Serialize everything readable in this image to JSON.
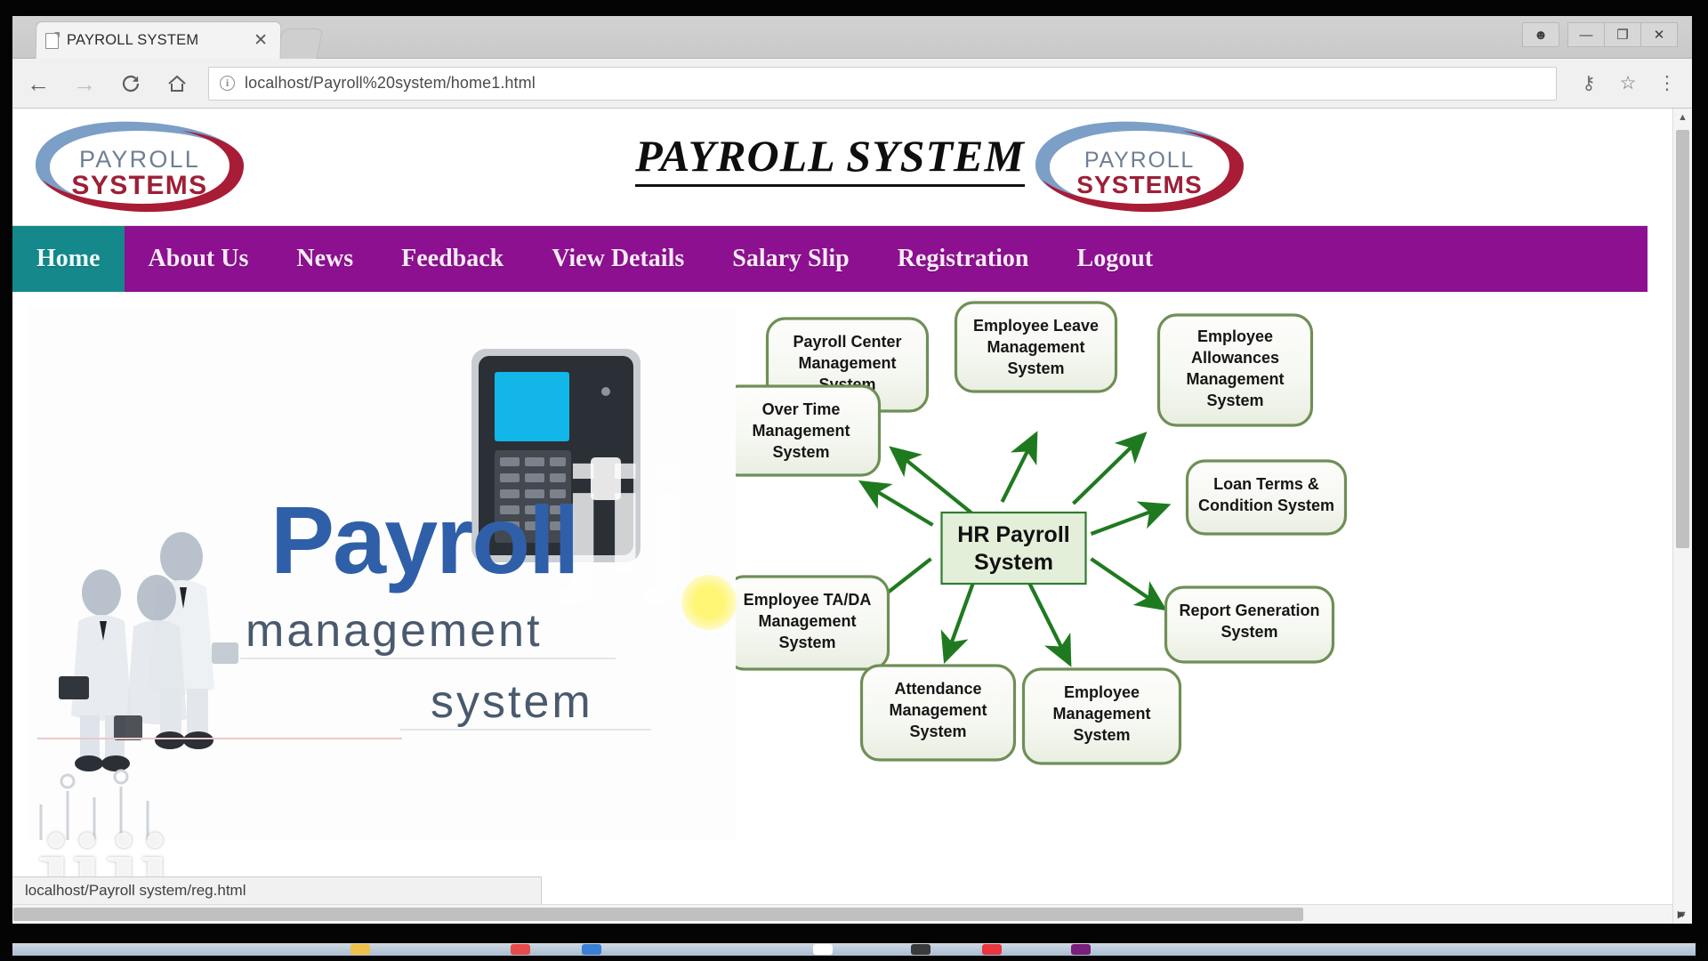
{
  "browser": {
    "tab_title": "PAYROLL SYSTEM",
    "tab_close_glyph": "✕",
    "url_display": "localhost/Payroll%20system/home1.html",
    "url_scheme_icon": "info-icon",
    "back_glyph": "←",
    "forward_glyph": "→",
    "reload_glyph": "C",
    "home_glyph": "⌂",
    "key_glyph": "⚷",
    "star_glyph": "☆",
    "menu_glyph": "⋮",
    "window_person_glyph": "☻",
    "window_minimize_glyph": "—",
    "window_restore_glyph": "❐",
    "window_close_glyph": "✕",
    "status_text": "localhost/Payroll system/reg.html"
  },
  "site": {
    "title": "PAYROLL SYSTEM",
    "logo": {
      "word_top": "PAYROLL",
      "word_bottom": "SYSTEMS",
      "color_top": "#6f7f93",
      "color_bottom": "#9d1f36",
      "swoosh_blue": "#7b9fc7",
      "swoosh_red": "#a81c36"
    },
    "nav": {
      "bg_color": "#8d1090",
      "active_color": "#15888b",
      "items": [
        {
          "label": "Home",
          "active": true
        },
        {
          "label": "About Us",
          "active": false
        },
        {
          "label": "News",
          "active": false
        },
        {
          "label": "Feedback",
          "active": false
        },
        {
          "label": "View Details",
          "active": false
        },
        {
          "label": "Salary Slip",
          "active": false
        },
        {
          "label": "Registration",
          "active": false
        },
        {
          "label": "Logout",
          "active": false
        }
      ]
    }
  },
  "promo": {
    "word_main": "Payroll",
    "word_sub": "management",
    "word_sub2": "system",
    "color_main": "#2f5fa8",
    "color_sub": "#4a5a6e",
    "watermark": "jiji"
  },
  "diagram": {
    "type": "hub-and-spoke",
    "center": {
      "label": "HR Payroll\nSystem",
      "line1": "HR Payroll",
      "line2": "System",
      "fill": "#e4efd9",
      "stroke": "#2f7d2f"
    },
    "node_fill": "#f4f7f0",
    "node_stroke": "#6f8f56",
    "arrow_color": "#1f7a1f",
    "nodes": [
      {
        "id": "payroll-center",
        "lines": [
          "Payroll Center",
          "Management",
          "System"
        ]
      },
      {
        "id": "employee-leave",
        "lines": [
          "Employee Leave",
          "Management",
          "System"
        ]
      },
      {
        "id": "employee-allowances",
        "lines": [
          "Employee",
          "Allowances",
          "Management",
          "System"
        ]
      },
      {
        "id": "over-time",
        "lines": [
          "Over Time",
          "Management",
          "System"
        ]
      },
      {
        "id": "loan-terms",
        "lines": [
          "Loan Terms &",
          "Condition System"
        ]
      },
      {
        "id": "employee-ta-da",
        "lines": [
          "Employee TA/DA",
          "Management",
          "System"
        ]
      },
      {
        "id": "report-generation",
        "lines": [
          "Report Generation",
          "System"
        ]
      },
      {
        "id": "attendance",
        "lines": [
          "Attendance",
          "Management",
          "System"
        ]
      },
      {
        "id": "employee-management",
        "lines": [
          "Employee",
          "Management",
          "System"
        ]
      }
    ]
  }
}
